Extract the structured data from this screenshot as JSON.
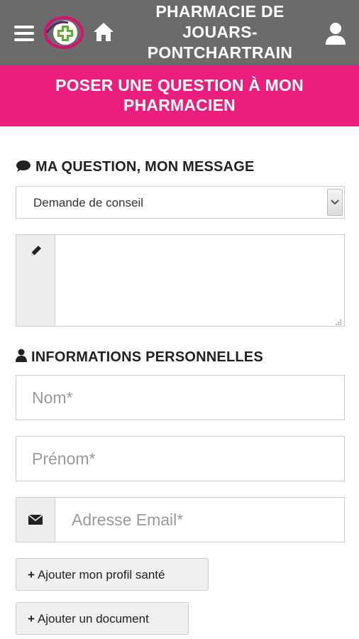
{
  "header": {
    "title": "PHARMACIE DE JOUARS-PONTCHARTRAIN",
    "title_lines": [
      "PHARMACIE DE",
      "JOUARS-",
      "PONTCHARTRAIN"
    ],
    "bar_color": "#6b6b6b",
    "icons": {
      "menu": "menu-icon",
      "logo": "pharmacy-cross-logo",
      "home": "home-icon",
      "user": "user-icon"
    }
  },
  "banner": {
    "lines": [
      "POSER UNE QUESTION À MON",
      "PHARMACIEN"
    ],
    "color": "#e91e7d"
  },
  "question_section": {
    "title": "MA QUESTION, MON MESSAGE",
    "icon": "comment-icon",
    "request_type": {
      "selected": "Demande de conseil"
    },
    "message": {
      "value": "",
      "icon": "pencil-icon"
    }
  },
  "personal_section": {
    "title": "INFORMATIONS PERSONNELLES",
    "icon": "user-icon",
    "fields": {
      "nom_placeholder": "Nom*",
      "prenom_placeholder": "Prénom*",
      "email_placeholder": "Adresse Email*",
      "email_icon": "envelope-icon"
    }
  },
  "actions": {
    "add_health_profile": "Ajouter mon profil santé",
    "add_document": "Ajouter un document"
  }
}
